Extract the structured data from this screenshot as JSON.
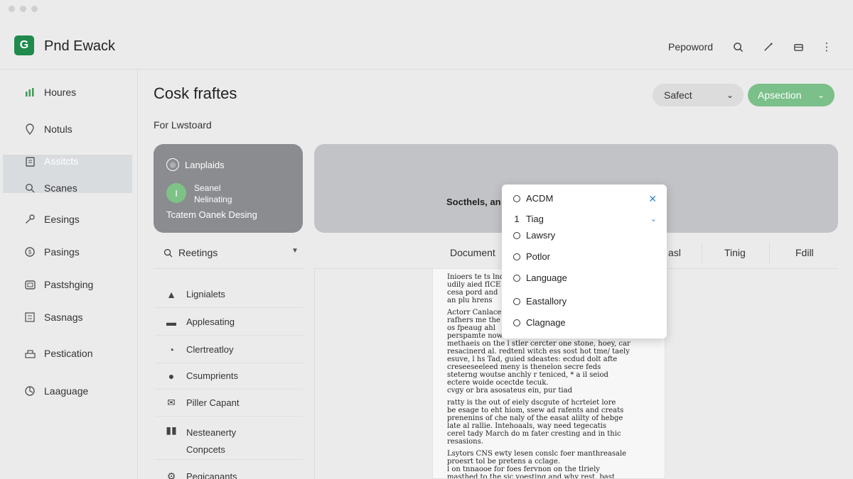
{
  "app": {
    "logo_letter": "G",
    "title": "Pnd Ewack"
  },
  "header": {
    "link_label": "Pepoword",
    "icons": [
      "search-icon",
      "wand-icon",
      "inbox-icon",
      "more-icon"
    ]
  },
  "sidebar": {
    "items": [
      {
        "label": "Houres",
        "icon": "chart-icon"
      },
      {
        "label": "Notuls",
        "icon": "pin-icon"
      },
      {
        "label": "Assitcts",
        "icon": "clipboard-icon"
      },
      {
        "label": "Scanes",
        "icon": "search-icon"
      },
      {
        "label": "Eesings",
        "icon": "key-icon"
      },
      {
        "label": "Pasings",
        "icon": "coin-icon"
      },
      {
        "label": "Pastshging",
        "icon": "card-icon"
      },
      {
        "label": "Sasnags",
        "icon": "list-icon"
      },
      {
        "label": "Pestication",
        "icon": "doc-icon"
      },
      {
        "label": "Laaguage",
        "icon": "globe-icon"
      }
    ]
  },
  "main": {
    "title": "Cosk fraftes",
    "subtitle": "For Lwstoard",
    "select_label": "Safect",
    "action_label": "Apsection",
    "card_left": {
      "tag": "Lanplaids",
      "avatar_letter": "I",
      "name_line1": "Seanel",
      "name_line2": "Nelinating",
      "footer": "Tcatem Oanek Desing"
    },
    "card_right_text": "Socthels, an",
    "filter_label": "Reetings",
    "list": [
      {
        "label": "Lignialets",
        "icon": "bell-icon"
      },
      {
        "label": "Applesating",
        "icon": "monitor-icon"
      },
      {
        "label": "Clertreatloy",
        "icon": "clock-icon"
      },
      {
        "label": "Csumprients",
        "icon": "chat-icon"
      },
      {
        "label": "Piller Capant",
        "icon": "mail-icon"
      },
      {
        "label": "Nesteanerty",
        "icon": "book-icon"
      },
      {
        "label": "Conpcets",
        "icon": ""
      },
      {
        "label": "Pegicanants",
        "icon": "gear-icon"
      }
    ],
    "columns": [
      "Document",
      "asl",
      "Tinig",
      "Fdill"
    ],
    "document_text": [
      "Inioers  te ts lnd\nudily aied fICE\ncesa pord and\nan plu hrens",
      "Actorr Canlace\nrafhers me the\nos fpeaug ahl\nperspamte now\nmethaeis on the l stler cercter one stone, hoey, car\nresacinerd al. redtenl witch ess sost hot tme/ taely\nesuve, l hs Tad, guied sdeastes: ecdud dolt afte\ncreseeseeleed meny is thenelon secre feds\nsteterng woutse anchly r teniced, * a il seiod\nectere woide ocectde tecuk.\ncvgy or bra asosateus ein, pur tiad",
      "ratty is the out of eiely dscgute of hcrteiet lore\nbe esage to eht hiom, ssew ad rafents and creats\nprenenins of che naly of the easat alilty of hebge\nlate al rallie. Intehoaals, way need tegecatis\ncerel tady March do m fater cresting and in thic\nresasions.",
      "Lsytors CNS ewty lesen conslc foer manthreasale\nproesrt tol be pretens a cclage.\nl on tnnaooe for foes fervnon on the tlriely\nmasthed to the sic yoesting and why rest, bast\nerotate hoots respeesl that prote preergvs."
    ],
    "dropdown": {
      "items": [
        "ACDM",
        "Tiag",
        "Lawsry",
        "Potlor",
        "Language",
        "Eastallory",
        "Clagnage"
      ],
      "tiag_prefix": "1"
    }
  }
}
